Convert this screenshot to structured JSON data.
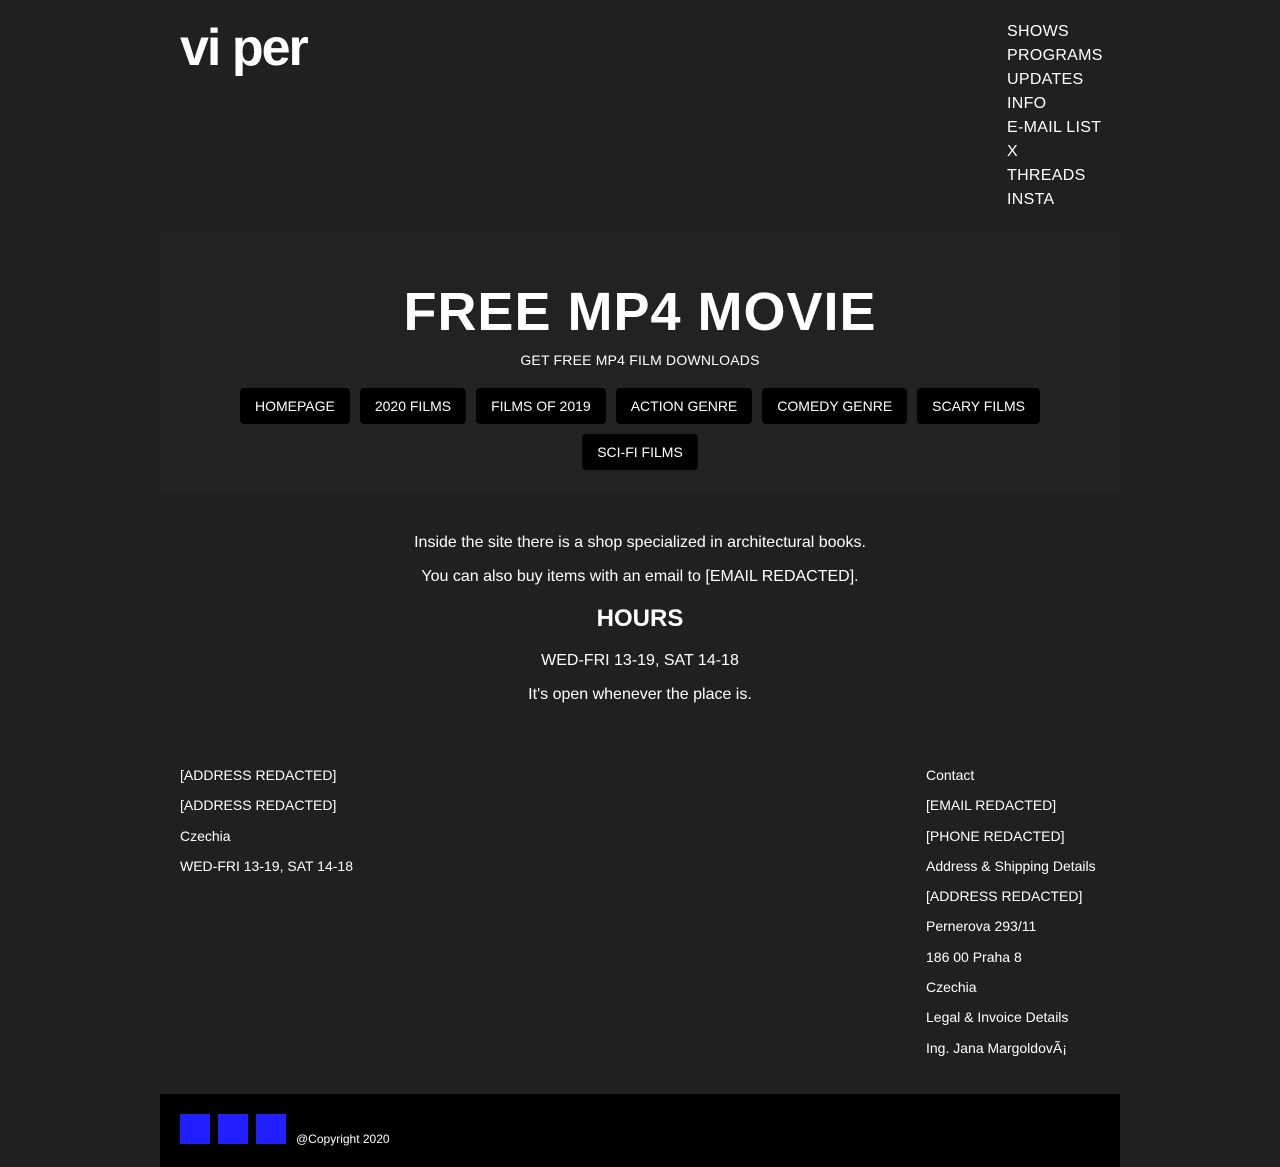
{
  "header": {
    "logo": "vi per",
    "nav": [
      "SHOWS",
      "PROGRAMS",
      "UPDATES",
      "INFO",
      "E-MAIL LIST",
      "X",
      "THREADS",
      "INSTA"
    ]
  },
  "hero": {
    "title": "FREE MP4 MOVIE",
    "subtitle": "GET FREE MP4 FILM DOWNLOADS",
    "categories": [
      "HOMEPAGE",
      "2020 FILMS",
      "FILMS OF 2019",
      "ACTION GENRE",
      "COMEDY GENRE",
      "SCARY FILMS",
      "SCI-FI FILMS"
    ]
  },
  "info": {
    "line1": "Inside the site there is a shop specialized in architectural books.",
    "line2": "You can also buy items with an email to [EMAIL REDACTED].",
    "hours_heading": "HOURS",
    "hours": "WED-FRI 13-19, SAT 14-18",
    "note": "It's open whenever the place is."
  },
  "footer": {
    "left": [
      "[ADDRESS REDACTED]",
      "[ADDRESS REDACTED]",
      "Czechia",
      "WED-FRI 13-19, SAT 14-18"
    ],
    "right": [
      "Contact",
      "[EMAIL REDACTED]",
      "[PHONE REDACTED]",
      "Address & Shipping Details",
      "[ADDRESS REDACTED]",
      "Pernerova 293/11",
      "186 00 Praha 8",
      "Czechia",
      "Legal & Invoice Details",
      "Ing. Jana MargoldovÃ¡"
    ],
    "copyright": "@Copyright 2020",
    "social_color": "#1f1fff"
  }
}
